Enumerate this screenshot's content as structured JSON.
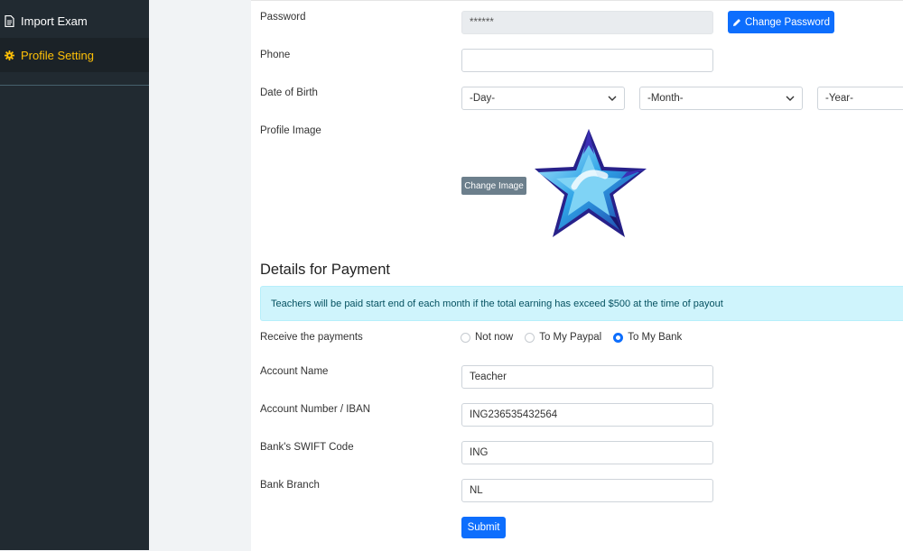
{
  "sidebar": {
    "items": [
      {
        "label": "Import Exam",
        "icon": "file-icon"
      },
      {
        "label": "Profile Setting",
        "icon": "gear-icon",
        "active": true
      }
    ]
  },
  "form": {
    "password": {
      "label": "Password",
      "value": "******",
      "button": "Change Password"
    },
    "phone": {
      "label": "Phone",
      "value": ""
    },
    "dob": {
      "label": "Date of Birth",
      "day": "-Day-",
      "month": "-Month-",
      "year": "-Year-"
    },
    "profile_image": {
      "label": "Profile Image",
      "button": "Change Image"
    }
  },
  "payment": {
    "title": "Details for Payment",
    "notice": "Teachers will be paid start end of each month if the total earning has exceed $500 at the time of payout",
    "receive": {
      "label": "Receive the payments",
      "options": [
        "Not now",
        "To My Paypal",
        "To My Bank"
      ],
      "selected": "To My Bank"
    },
    "account_name": {
      "label": "Account Name",
      "value": "Teacher"
    },
    "account_number": {
      "label": "Account Number / IBAN",
      "value": "ING236535432564"
    },
    "swift": {
      "label": "Bank's SWIFT Code",
      "value": "ING"
    },
    "branch": {
      "label": "Bank Branch",
      "value": "NL"
    },
    "submit": "Submit"
  },
  "colors": {
    "sidebar_bg": "#212a31",
    "active_text": "#ffc107",
    "primary": "#0d6efd",
    "alert_bg": "#cff4fc"
  }
}
